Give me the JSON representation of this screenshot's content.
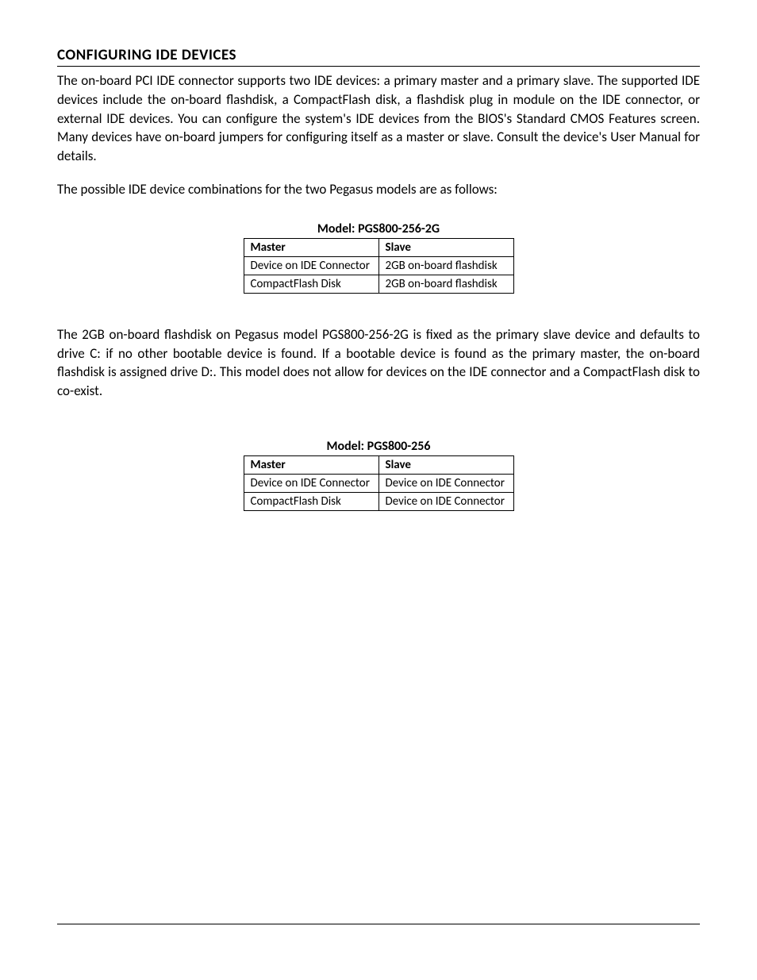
{
  "heading": "CONFIGURING IDE DEVICES",
  "paragraph1": "The on-board PCI IDE connector supports two IDE devices: a primary master and a primary slave.  The supported IDE devices include the on-board flashdisk, a CompactFlash disk, a flashdisk plug in module on the IDE connector, or external IDE devices.  You can configure the system's IDE devices from the BIOS's Standard CMOS Features screen.  Many devices have on-board jumpers for configuring itself as a master or slave.  Consult the device's User Manual for details.",
  "paragraph2": "The possible IDE device combinations for the two Pegasus models are as follows:",
  "table1": {
    "title": "Model:  PGS800-256-2G",
    "headers": {
      "col1": "Master",
      "col2": "Slave"
    },
    "rows": [
      {
        "col1": "Device on IDE Connector",
        "col2": "2GB on-board flashdisk"
      },
      {
        "col1": "CompactFlash Disk",
        "col2": "2GB on-board flashdisk"
      }
    ]
  },
  "paragraph3": "The 2GB on-board flashdisk on Pegasus model PGS800-256-2G is fixed as the primary slave device and defaults to drive C: if no other bootable device is found.  If a bootable device is found as the primary master, the on-board flashdisk is assigned drive D:.  This model does not allow for devices on the IDE connector and a CompactFlash disk to co-exist.",
  "table2": {
    "title": "Model:  PGS800-256",
    "headers": {
      "col1": "Master",
      "col2": "Slave"
    },
    "rows": [
      {
        "col1": "Device on IDE Connector",
        "col2": "Device on IDE Connector"
      },
      {
        "col1": "CompactFlash Disk",
        "col2": "Device on IDE Connector"
      }
    ]
  }
}
